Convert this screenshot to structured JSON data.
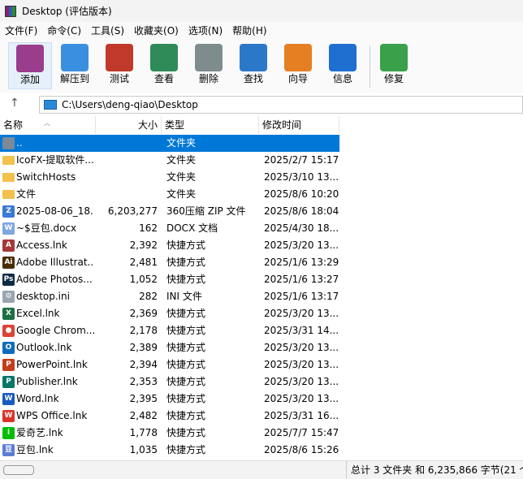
{
  "window": {
    "title": "Desktop (评估版本)"
  },
  "menu": [
    "文件(F)",
    "命令(C)",
    "工具(S)",
    "收藏夹(O)",
    "选项(N)",
    "帮助(H)"
  ],
  "toolbar": [
    {
      "label": "添加",
      "icon": "add-archive-icon",
      "color": "#9a3d8c"
    },
    {
      "label": "解压到",
      "icon": "extract-folder-icon",
      "color": "#3b8fe0"
    },
    {
      "label": "测试",
      "icon": "test-clipboard-icon",
      "color": "#c0392b"
    },
    {
      "label": "查看",
      "icon": "view-book-icon",
      "color": "#2e8b57"
    },
    {
      "label": "删除",
      "icon": "trash-icon",
      "color": "#7f8c8d"
    },
    {
      "label": "查找",
      "icon": "magnifier-icon",
      "color": "#2c78c8"
    },
    {
      "label": "向导",
      "icon": "wizard-wand-icon",
      "color": "#e67e22"
    },
    {
      "label": "信息",
      "icon": "info-icon",
      "color": "#1f6fd1"
    },
    {
      "label": "修复",
      "icon": "repair-kit-icon",
      "color": "#3aa04a"
    }
  ],
  "address": {
    "path": "C:\\Users\\deng-qiao\\Desktop"
  },
  "columns": {
    "name": "名称",
    "size": "大小",
    "type": "类型",
    "date": "修改时间"
  },
  "files": [
    {
      "name": "..",
      "size": "",
      "type": "文件夹",
      "date": "",
      "icon": "parent-folder-icon",
      "color": "#7a8a99",
      "glyph": ""
    },
    {
      "name": "IcoFX-提取软件...",
      "size": "",
      "type": "文件夹",
      "date": "2025/2/7 15:17",
      "icon": "folder-icon",
      "color": "#f2c14e",
      "glyph": ""
    },
    {
      "name": "SwitchHosts",
      "size": "",
      "type": "文件夹",
      "date": "2025/3/10 13...",
      "icon": "folder-icon",
      "color": "#f2c14e",
      "glyph": ""
    },
    {
      "name": "文件",
      "size": "",
      "type": "文件夹",
      "date": "2025/8/6 10:20",
      "icon": "folder-icon",
      "color": "#f2c14e",
      "glyph": ""
    },
    {
      "name": "2025-08-06_18...",
      "size": "6,203,277",
      "type": "360压缩 ZIP 文件",
      "date": "2025/8/6 18:04",
      "icon": "zip-icon",
      "color": "#3a7bd5",
      "glyph": "Z"
    },
    {
      "name": "~$豆包.docx",
      "size": "162",
      "type": "DOCX 文档",
      "date": "2025/4/30 18...",
      "icon": "docx-icon",
      "color": "#7ea6e0",
      "glyph": "W"
    },
    {
      "name": "Access.lnk",
      "size": "2,392",
      "type": "快捷方式",
      "date": "2025/3/20 13...",
      "icon": "access-icon",
      "color": "#a4373a",
      "glyph": "A"
    },
    {
      "name": "Adobe Illustrat...",
      "size": "2,481",
      "type": "快捷方式",
      "date": "2025/1/6 13:29",
      "icon": "illustrator-icon",
      "color": "#4a2c00",
      "glyph": "Ai"
    },
    {
      "name": "Adobe Photos...",
      "size": "1,052",
      "type": "快捷方式",
      "date": "2025/1/6 13:27",
      "icon": "photoshop-icon",
      "color": "#0b2a44",
      "glyph": "Ps"
    },
    {
      "name": "desktop.ini",
      "size": "282",
      "type": "INI 文件",
      "date": "2025/1/6 13:17",
      "icon": "ini-file-icon",
      "color": "#9aa5b1",
      "glyph": "⚙"
    },
    {
      "name": "Excel.lnk",
      "size": "2,369",
      "type": "快捷方式",
      "date": "2025/3/20 13...",
      "icon": "excel-icon",
      "color": "#1d6f42",
      "glyph": "X"
    },
    {
      "name": "Google Chrom...",
      "size": "2,178",
      "type": "快捷方式",
      "date": "2025/3/31 14...",
      "icon": "chrome-icon",
      "color": "#db4437",
      "glyph": "●"
    },
    {
      "name": "Outlook.lnk",
      "size": "2,389",
      "type": "快捷方式",
      "date": "2025/3/20 13...",
      "icon": "outlook-icon",
      "color": "#0f6cbd",
      "glyph": "O"
    },
    {
      "name": "PowerPoint.lnk",
      "size": "2,394",
      "type": "快捷方式",
      "date": "2025/3/20 13...",
      "icon": "powerpoint-icon",
      "color": "#c43e1c",
      "glyph": "P"
    },
    {
      "name": "Publisher.lnk",
      "size": "2,353",
      "type": "快捷方式",
      "date": "2025/3/20 13...",
      "icon": "publisher-icon",
      "color": "#077568",
      "glyph": "P"
    },
    {
      "name": "Word.lnk",
      "size": "2,395",
      "type": "快捷方式",
      "date": "2025/3/20 13...",
      "icon": "word-icon",
      "color": "#185abd",
      "glyph": "W"
    },
    {
      "name": "WPS Office.lnk",
      "size": "2,482",
      "type": "快捷方式",
      "date": "2025/3/31 16...",
      "icon": "wps-icon",
      "color": "#d9342b",
      "glyph": "W"
    },
    {
      "name": "爱奇艺.lnk",
      "size": "1,778",
      "type": "快捷方式",
      "date": "2025/7/7 15:47",
      "icon": "iqiyi-icon",
      "color": "#00be06",
      "glyph": "i"
    },
    {
      "name": "豆包.lnk",
      "size": "1,035",
      "type": "快捷方式",
      "date": "2025/8/6 15:26",
      "icon": "doubao-icon",
      "color": "#5b7bd5",
      "glyph": "豆"
    }
  ],
  "selected_index": 0,
  "status": {
    "text": "总计 3 文件夹 和 6,235,866 字节(21 个"
  }
}
